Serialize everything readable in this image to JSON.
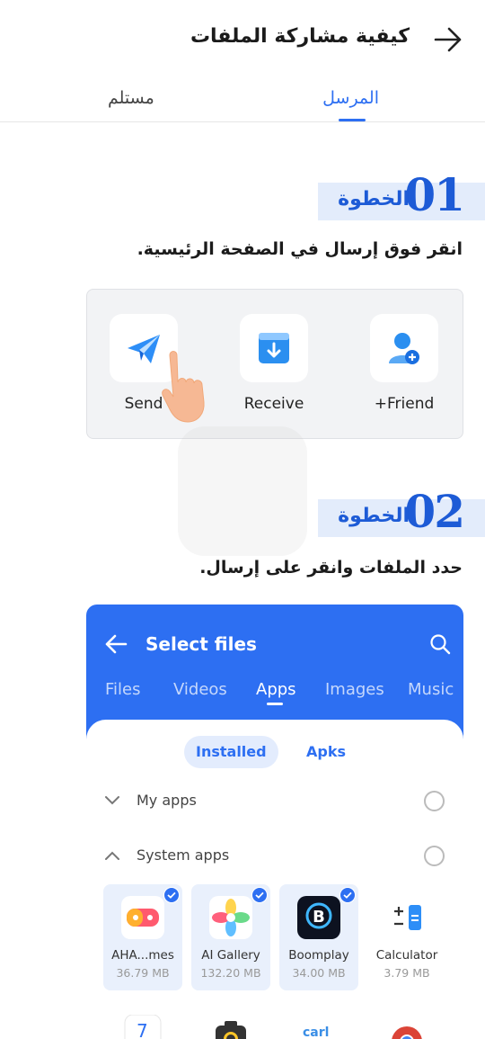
{
  "header": {
    "title": "كيفية مشاركة الملفات",
    "back_icon": "arrow-right-icon"
  },
  "tabs": {
    "sender": "المرسل",
    "receiver": "مستلم"
  },
  "step1": {
    "number": "01",
    "word": "الخطوة",
    "instruction": "انقر فوق إرسال في الصفحة الرئيسية."
  },
  "step2": {
    "number": "02",
    "word": "الخطوة",
    "instruction": "حدد الملفات وانقر على إرسال."
  },
  "home_actions": {
    "send": "Send",
    "receive": "Receive",
    "friend": "+Friend"
  },
  "select_files": {
    "title": "Select files",
    "tabs": [
      "Files",
      "Videos",
      "Apps",
      "Images",
      "Music"
    ],
    "active_tab": "Apps",
    "pills": {
      "installed": "Installed",
      "apks": "Apks"
    },
    "groups": {
      "my_apps": "My apps",
      "system_apps": "System apps"
    },
    "apps": [
      {
        "name": "AHA...mes",
        "size": "36.79 MB",
        "selected": true
      },
      {
        "name": "AI Gallery",
        "size": "132.20 MB",
        "selected": true
      },
      {
        "name": "Boomplay",
        "size": "34.00 MB",
        "selected": true
      },
      {
        "name": "Calculator",
        "size": "3.79 MB",
        "selected": false
      }
    ],
    "partial_icon_text": {
      "calendar": "7",
      "carlcare": "carl"
    }
  },
  "colors": {
    "accent": "#2d6ff2",
    "badge_bg": "#e3ecfb",
    "step_text": "#1d5bd6"
  }
}
